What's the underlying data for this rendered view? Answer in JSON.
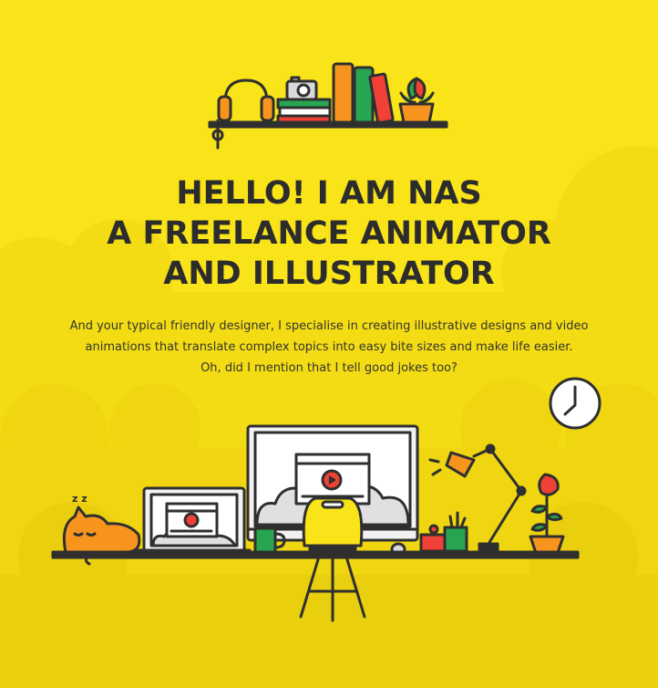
{
  "headline": {
    "line1": "HELLO! I AM NAS",
    "line2": "A FREELANCE ANIMATOR",
    "line3": "AND ILLUSTRATOR"
  },
  "intro": {
    "line1": "And your typical friendly designer, I specialise in creating illustrative designs and video",
    "line2": "animations that translate complex topics into easy bite sizes and make life easier.",
    "line3": "Oh, did I mention that I tell good jokes too?"
  },
  "illustration": {
    "shelf_items": [
      "headphones-icon",
      "camera-icon",
      "stacked-books-icon",
      "upright-books-icon",
      "potted-plant-icon"
    ],
    "desk_items": [
      "clock-icon",
      "sleeping-cat-icon",
      "laptop-icon",
      "monitor-icon",
      "mug-icon",
      "chair-icon",
      "mouse-icon",
      "pencil-cup-icon",
      "desk-lamp-icon",
      "flower-pot-icon"
    ],
    "sleep_text": "z z"
  },
  "colors": {
    "background": "#f9e319",
    "text": "#2c2c2c",
    "outline": "#2f2f2f",
    "orange": "#f7941d",
    "green": "#27a550",
    "red": "#ef4136",
    "screen": "#e6e6e6"
  }
}
